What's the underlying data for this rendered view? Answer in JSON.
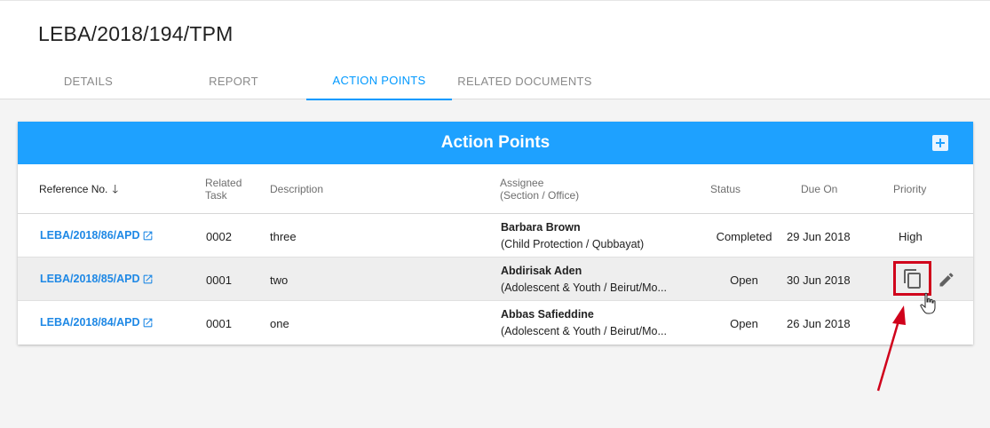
{
  "page": {
    "title": "LEBA/2018/194/TPM"
  },
  "tabs": [
    {
      "label": "DETAILS",
      "active": false
    },
    {
      "label": "REPORT",
      "active": false
    },
    {
      "label": "ACTION POINTS",
      "active": true
    },
    {
      "label": "RELATED DOCUMENTS",
      "active": false
    }
  ],
  "card": {
    "title": "Action Points",
    "add_icon": "plus-square-icon",
    "accent_color": "#1ea1ff"
  },
  "table": {
    "headers": {
      "reference": "Reference No.",
      "task_line1": "Related",
      "task_line2": "Task",
      "description": "Description",
      "assignee_line1": "Assignee",
      "assignee_line2": "(Section / Office)",
      "status": "Status",
      "due_on": "Due On",
      "priority": "Priority"
    },
    "sort_icon": "arrow-down-icon",
    "rows": [
      {
        "reference": "LEBA/2018/86/APD",
        "task": "0002",
        "description": "three",
        "assignee_name": "Barbara Brown",
        "assignee_section": "(Child Protection / Qubbayat)",
        "status": "Completed",
        "due_on": "29 Jun 2018",
        "priority": "High"
      },
      {
        "reference": "LEBA/2018/85/APD",
        "task": "0001",
        "description": "two",
        "assignee_name": "Abdirisak Aden",
        "assignee_section": "(Adolescent & Youth / Beirut/Mo...",
        "status": "Open",
        "due_on": "30 Jun 2018",
        "priority": ""
      },
      {
        "reference": "LEBA/2018/84/APD",
        "task": "0001",
        "description": "one",
        "assignee_name": "Abbas Safieddine",
        "assignee_section": "(Adolescent & Youth / Beirut/Mo...",
        "status": "Open",
        "due_on": "26 Jun 2018",
        "priority": ""
      }
    ],
    "row_actions": {
      "copy_icon": "copy-icon",
      "edit_icon": "pencil-icon"
    }
  },
  "annotation": {
    "highlight_color": "#d0021b"
  }
}
